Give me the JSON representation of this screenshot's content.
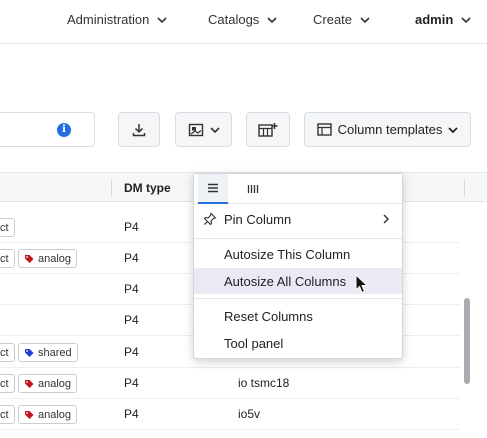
{
  "nav": {
    "items": [
      {
        "label": "Administration"
      },
      {
        "label": "Catalogs"
      },
      {
        "label": "Create"
      },
      {
        "label": "admin"
      }
    ]
  },
  "toolbar": {
    "search_value": "",
    "info_glyph": "i",
    "column_templates_label": "Column templates"
  },
  "grid": {
    "header": {
      "dm_type": "DM type"
    },
    "rows": [
      {
        "tag_ct": "ct",
        "tag": null,
        "dm_type": "P4",
        "name": ""
      },
      {
        "tag_ct": "ct",
        "tag": "analog",
        "tag_color": "#c0171c",
        "dm_type": "P4",
        "name": ""
      },
      {
        "tag_ct": null,
        "tag": null,
        "dm_type": "P4",
        "name": ""
      },
      {
        "tag_ct": null,
        "tag": null,
        "dm_type": "P4",
        "name": ""
      },
      {
        "tag_ct": "ct",
        "tag": "shared",
        "tag_color": "#1f3fd1",
        "dm_type": "P4",
        "name": ""
      },
      {
        "tag_ct": "ct",
        "tag": "analog",
        "tag_color": "#c0171c",
        "dm_type": "P4",
        "name": "io tsmc18"
      },
      {
        "tag_ct": "ct",
        "tag": "analog",
        "tag_color": "#c0171c",
        "dm_type": "P4",
        "name": "io5v"
      }
    ]
  },
  "menu": {
    "pin_column": "Pin Column",
    "autosize_this": "Autosize This Column",
    "autosize_all": "Autosize All Columns",
    "reset_columns": "Reset Columns",
    "tool_panel": "Tool panel"
  },
  "colors": {
    "accent": "#2a6fd6",
    "info": "#1f6fe0",
    "menu_hover": "#ece9f4",
    "tag_analog": "#c0171c",
    "tag_shared": "#1f3fd1"
  }
}
